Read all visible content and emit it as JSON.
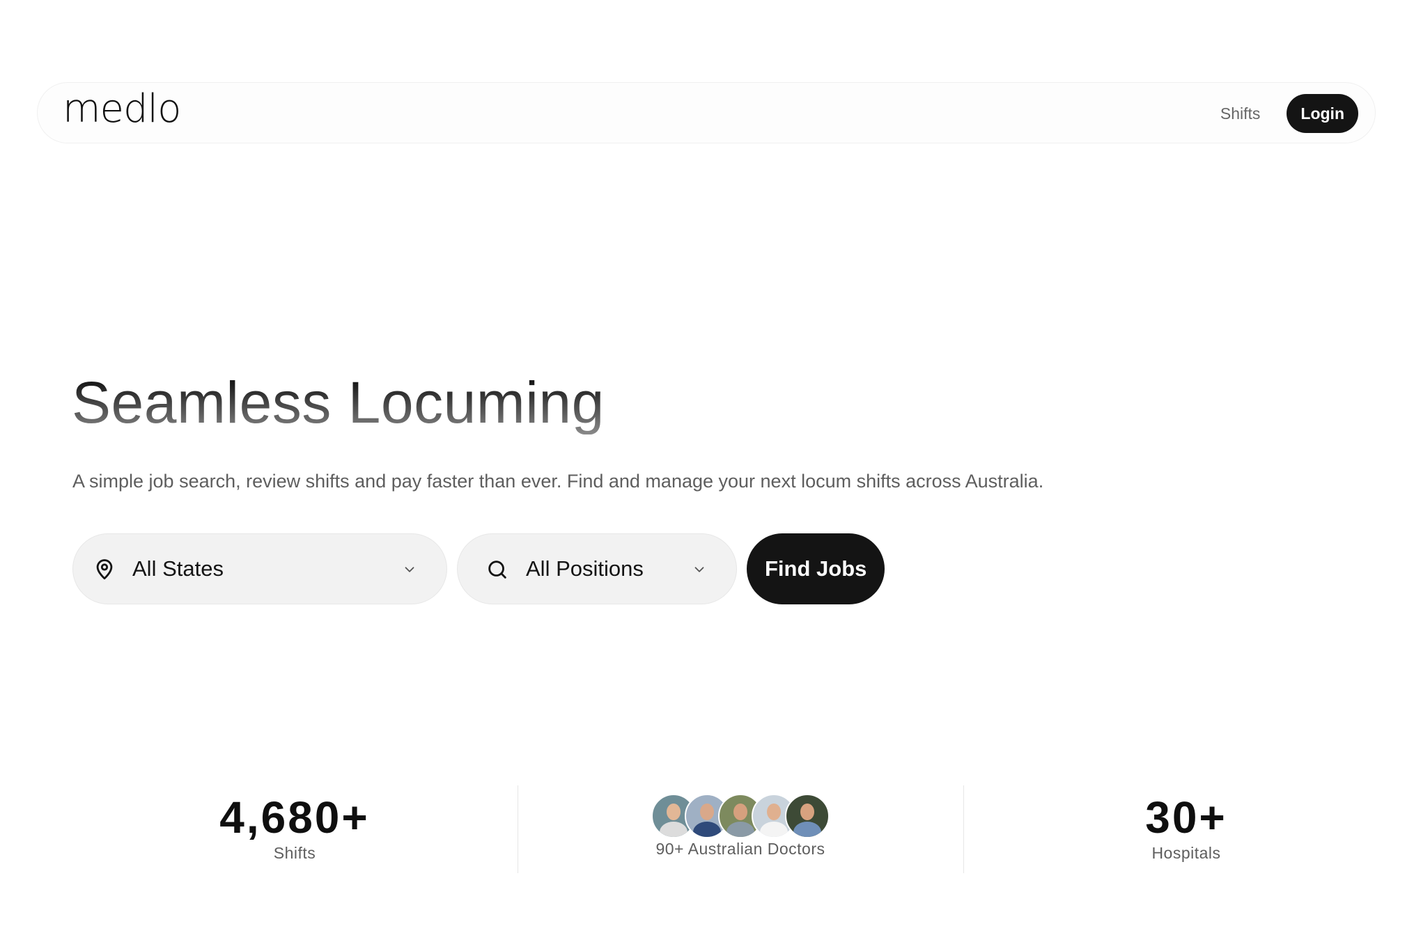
{
  "header": {
    "logo": "medlo",
    "nav_shifts": "Shifts",
    "login_label": "Login"
  },
  "hero": {
    "title": "Seamless Locuming",
    "subtitle": "A simple job search, review shifts and pay faster than ever. Find and manage your next locum shifts across Australia."
  },
  "search": {
    "states_value": "All States",
    "positions_value": "All Positions",
    "find_label": "Find Jobs",
    "icons": [
      "map-pin-icon",
      "search-icon",
      "chevron-down-icon"
    ]
  },
  "stats": {
    "shifts_value": "4,680+",
    "shifts_label": "Shifts",
    "doctors_label": "90+ Australian Doctors",
    "hospitals_value": "30+",
    "hospitals_label": "Hospitals"
  },
  "colors": {
    "accent": "#141414",
    "muted_text": "#5e5e5e",
    "pill_bg": "#f2f2f2"
  }
}
